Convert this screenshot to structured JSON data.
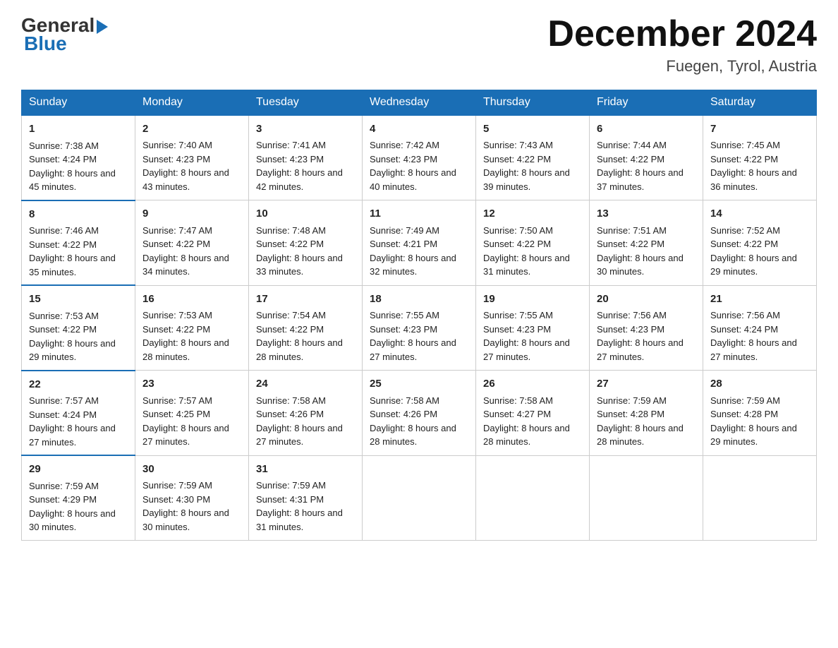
{
  "header": {
    "logo_general": "General",
    "logo_blue": "Blue",
    "month_title": "December 2024",
    "location": "Fuegen, Tyrol, Austria"
  },
  "days_of_week": [
    "Sunday",
    "Monday",
    "Tuesday",
    "Wednesday",
    "Thursday",
    "Friday",
    "Saturday"
  ],
  "weeks": [
    [
      {
        "day": "1",
        "sunrise": "7:38 AM",
        "sunset": "4:24 PM",
        "daylight": "8 hours and 45 minutes."
      },
      {
        "day": "2",
        "sunrise": "7:40 AM",
        "sunset": "4:23 PM",
        "daylight": "8 hours and 43 minutes."
      },
      {
        "day": "3",
        "sunrise": "7:41 AM",
        "sunset": "4:23 PM",
        "daylight": "8 hours and 42 minutes."
      },
      {
        "day": "4",
        "sunrise": "7:42 AM",
        "sunset": "4:23 PM",
        "daylight": "8 hours and 40 minutes."
      },
      {
        "day": "5",
        "sunrise": "7:43 AM",
        "sunset": "4:22 PM",
        "daylight": "8 hours and 39 minutes."
      },
      {
        "day": "6",
        "sunrise": "7:44 AM",
        "sunset": "4:22 PM",
        "daylight": "8 hours and 37 minutes."
      },
      {
        "day": "7",
        "sunrise": "7:45 AM",
        "sunset": "4:22 PM",
        "daylight": "8 hours and 36 minutes."
      }
    ],
    [
      {
        "day": "8",
        "sunrise": "7:46 AM",
        "sunset": "4:22 PM",
        "daylight": "8 hours and 35 minutes."
      },
      {
        "day": "9",
        "sunrise": "7:47 AM",
        "sunset": "4:22 PM",
        "daylight": "8 hours and 34 minutes."
      },
      {
        "day": "10",
        "sunrise": "7:48 AM",
        "sunset": "4:22 PM",
        "daylight": "8 hours and 33 minutes."
      },
      {
        "day": "11",
        "sunrise": "7:49 AM",
        "sunset": "4:21 PM",
        "daylight": "8 hours and 32 minutes."
      },
      {
        "day": "12",
        "sunrise": "7:50 AM",
        "sunset": "4:22 PM",
        "daylight": "8 hours and 31 minutes."
      },
      {
        "day": "13",
        "sunrise": "7:51 AM",
        "sunset": "4:22 PM",
        "daylight": "8 hours and 30 minutes."
      },
      {
        "day": "14",
        "sunrise": "7:52 AM",
        "sunset": "4:22 PM",
        "daylight": "8 hours and 29 minutes."
      }
    ],
    [
      {
        "day": "15",
        "sunrise": "7:53 AM",
        "sunset": "4:22 PM",
        "daylight": "8 hours and 29 minutes."
      },
      {
        "day": "16",
        "sunrise": "7:53 AM",
        "sunset": "4:22 PM",
        "daylight": "8 hours and 28 minutes."
      },
      {
        "day": "17",
        "sunrise": "7:54 AM",
        "sunset": "4:22 PM",
        "daylight": "8 hours and 28 minutes."
      },
      {
        "day": "18",
        "sunrise": "7:55 AM",
        "sunset": "4:23 PM",
        "daylight": "8 hours and 27 minutes."
      },
      {
        "day": "19",
        "sunrise": "7:55 AM",
        "sunset": "4:23 PM",
        "daylight": "8 hours and 27 minutes."
      },
      {
        "day": "20",
        "sunrise": "7:56 AM",
        "sunset": "4:23 PM",
        "daylight": "8 hours and 27 minutes."
      },
      {
        "day": "21",
        "sunrise": "7:56 AM",
        "sunset": "4:24 PM",
        "daylight": "8 hours and 27 minutes."
      }
    ],
    [
      {
        "day": "22",
        "sunrise": "7:57 AM",
        "sunset": "4:24 PM",
        "daylight": "8 hours and 27 minutes."
      },
      {
        "day": "23",
        "sunrise": "7:57 AM",
        "sunset": "4:25 PM",
        "daylight": "8 hours and 27 minutes."
      },
      {
        "day": "24",
        "sunrise": "7:58 AM",
        "sunset": "4:26 PM",
        "daylight": "8 hours and 27 minutes."
      },
      {
        "day": "25",
        "sunrise": "7:58 AM",
        "sunset": "4:26 PM",
        "daylight": "8 hours and 28 minutes."
      },
      {
        "day": "26",
        "sunrise": "7:58 AM",
        "sunset": "4:27 PM",
        "daylight": "8 hours and 28 minutes."
      },
      {
        "day": "27",
        "sunrise": "7:59 AM",
        "sunset": "4:28 PM",
        "daylight": "8 hours and 28 minutes."
      },
      {
        "day": "28",
        "sunrise": "7:59 AM",
        "sunset": "4:28 PM",
        "daylight": "8 hours and 29 minutes."
      }
    ],
    [
      {
        "day": "29",
        "sunrise": "7:59 AM",
        "sunset": "4:29 PM",
        "daylight": "8 hours and 30 minutes."
      },
      {
        "day": "30",
        "sunrise": "7:59 AM",
        "sunset": "4:30 PM",
        "daylight": "8 hours and 30 minutes."
      },
      {
        "day": "31",
        "sunrise": "7:59 AM",
        "sunset": "4:31 PM",
        "daylight": "8 hours and 31 minutes."
      },
      null,
      null,
      null,
      null
    ]
  ],
  "labels": {
    "sunrise": "Sunrise: ",
    "sunset": "Sunset: ",
    "daylight": "Daylight: "
  }
}
